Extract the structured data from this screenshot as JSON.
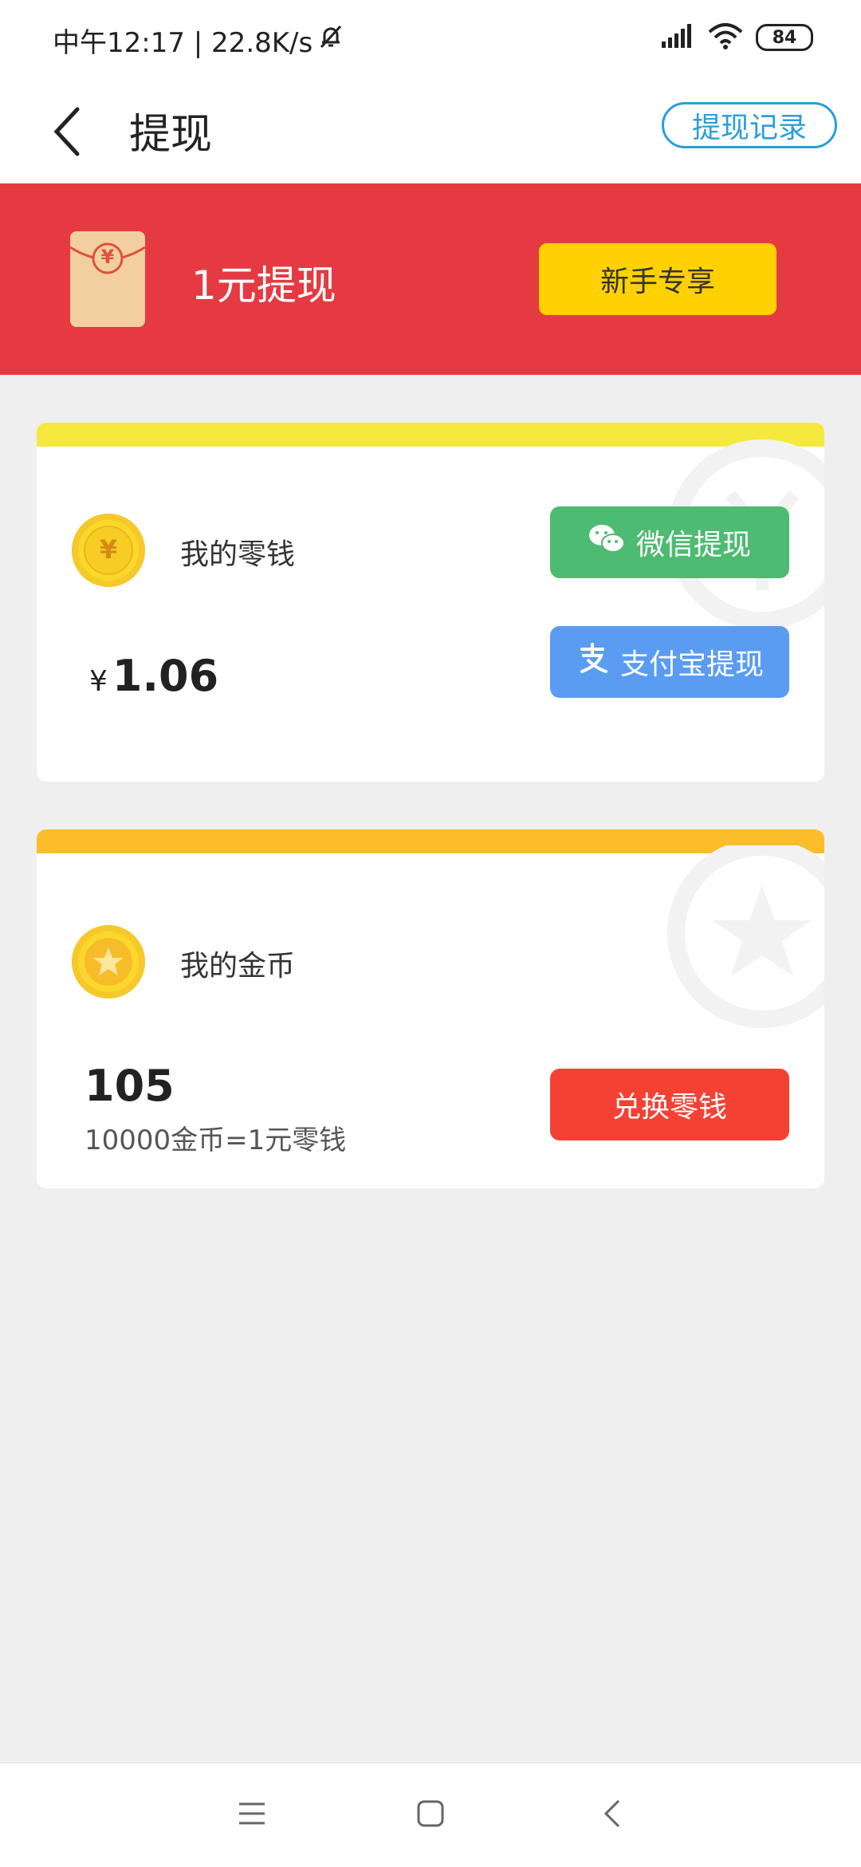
{
  "status": {
    "time_speed": "中午12:17 | 22.8K/s",
    "battery": "84"
  },
  "header": {
    "title": "提现",
    "record_label": "提现记录"
  },
  "banner": {
    "text": "1元提现",
    "button_label": "新手专享",
    "envelope_symbol": "¥"
  },
  "wallet": {
    "label": "我的零钱",
    "currency": "¥",
    "amount": "1.06",
    "wechat_label": "微信提现",
    "alipay_label": "支付宝提现",
    "coin_symbol": "¥"
  },
  "coins": {
    "label": "我的金币",
    "count": "105",
    "rate": "10000金币=1元零钱",
    "exchange_label": "兑换零钱"
  },
  "colors": {
    "banner": "#e53a42",
    "newbie_button": "#ffd100",
    "wechat": "#4dbb71",
    "alipay": "#5b9cf3",
    "exchange": "#f44134",
    "accent_link": "#2a9fd8"
  },
  "icons": {
    "back": "chevron-left-icon",
    "mute": "bell-off-icon",
    "signal": "signal-icon",
    "wifi": "wifi-icon",
    "wechat": "wechat-icon",
    "alipay": "alipay-icon",
    "nav_menu": "menu-icon",
    "nav_home": "home-square-icon",
    "nav_back": "back-arrow-icon"
  }
}
